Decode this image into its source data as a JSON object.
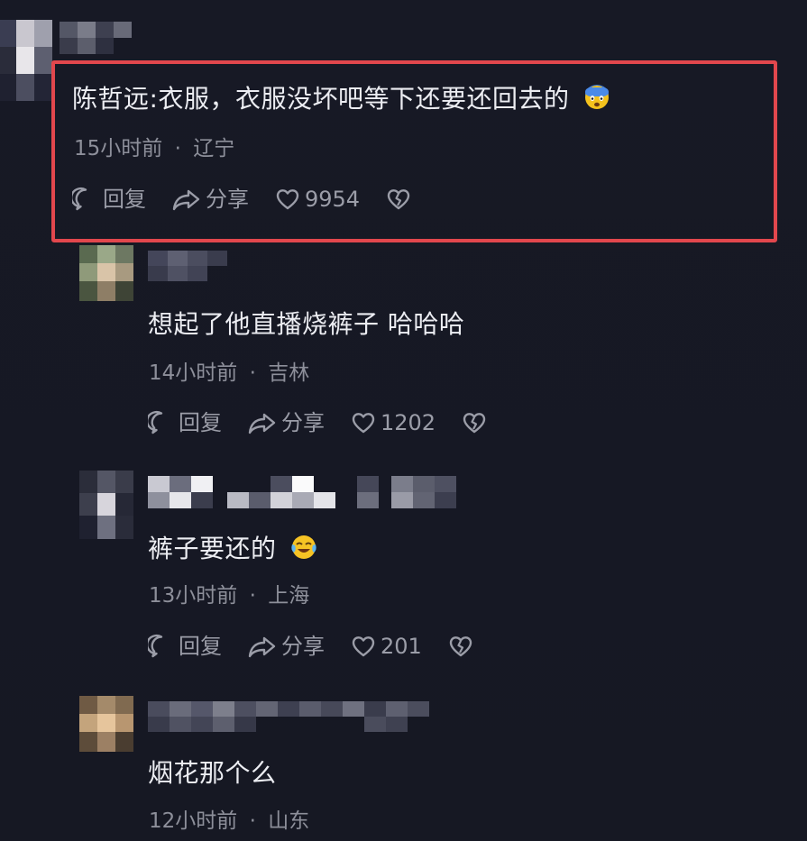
{
  "comments": [
    {
      "author": "陈哲远",
      "separator": ":",
      "text": "衣服，衣服没坏吧等下还要还回去的",
      "emoji": "scared-face-emoji",
      "time": "15小时前",
      "dot": "·",
      "location": "辽宁",
      "reply_label": "回复",
      "share_label": "分享",
      "likes": "9954",
      "highlighted": true
    },
    {
      "text": "想起了他直播烧裤子 哈哈哈",
      "time": "14小时前",
      "dot": "·",
      "location": "吉林",
      "reply_label": "回复",
      "share_label": "分享",
      "likes": "1202"
    },
    {
      "text": "裤子要还的",
      "emoji": "crying-laughing-emoji",
      "time": "13小时前",
      "dot": "·",
      "location": "上海",
      "reply_label": "回复",
      "share_label": "分享",
      "likes": "201"
    },
    {
      "text": "烟花那个么",
      "time": "12小时前",
      "dot": "·",
      "location": "山东"
    }
  ],
  "colors": {
    "background": "#161824",
    "highlight_border": "#e2474d",
    "meta_text": "#8d8f9a",
    "comment_text": "#ecedf2"
  }
}
